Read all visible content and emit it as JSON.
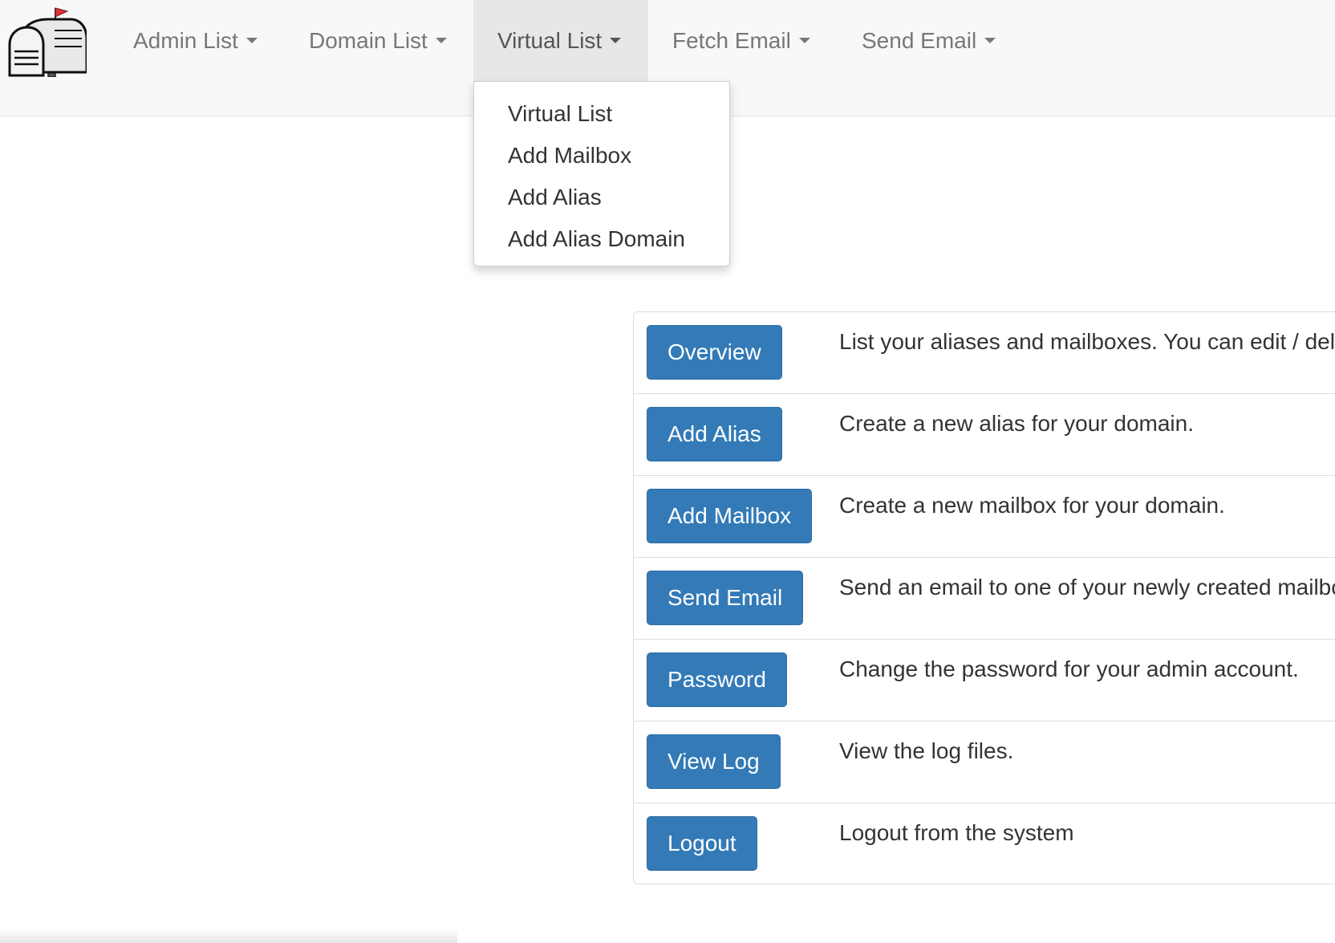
{
  "navbar": {
    "logo_icon": "mailbox-icon",
    "items": [
      {
        "label": "Admin List"
      },
      {
        "label": "Domain List"
      },
      {
        "label": "Virtual List"
      },
      {
        "label": "Fetch Email"
      },
      {
        "label": "Send Email"
      }
    ],
    "active_index": 2
  },
  "dropdown": {
    "items": [
      {
        "label": "Virtual List"
      },
      {
        "label": "Add Mailbox"
      },
      {
        "label": "Add Alias"
      },
      {
        "label": "Add Alias Domain"
      }
    ]
  },
  "panel": {
    "rows": [
      {
        "button": "Overview",
        "description": "List your aliases and mailboxes. You can edit / del"
      },
      {
        "button": "Add Alias",
        "description": "Create a new alias for your domain."
      },
      {
        "button": "Add Mailbox",
        "description": "Create a new mailbox for your domain."
      },
      {
        "button": "Send Email",
        "description": "Send an email to one of your newly created mailbo"
      },
      {
        "button": "Password",
        "description": "Change the password for your admin account."
      },
      {
        "button": "View Log",
        "description": "View the log files."
      },
      {
        "button": "Logout",
        "description": "Logout from the system"
      }
    ]
  },
  "colors": {
    "primary_button": "#337ab7",
    "navbar_bg": "#f8f8f8",
    "nav_active_bg": "#e7e7e7"
  }
}
